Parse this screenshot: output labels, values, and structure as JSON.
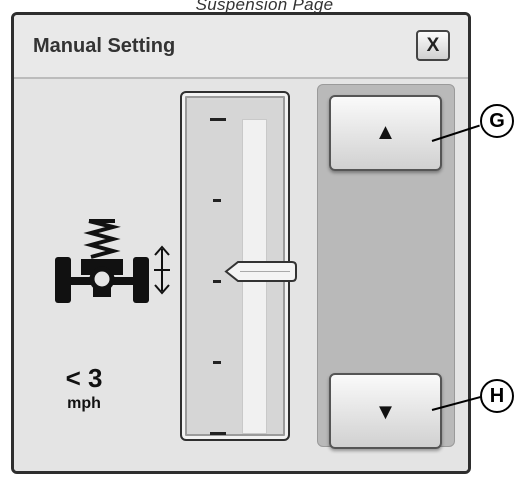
{
  "caption": "Suspension Page",
  "dialog": {
    "title": "Manual Setting",
    "close_label": "X"
  },
  "speed": {
    "value": "< 3",
    "unit": "mph"
  },
  "slider": {
    "level_fraction": 0.5,
    "tick_count": 5
  },
  "buttons": {
    "up_glyph": "▲",
    "down_glyph": "▼"
  },
  "callouts": {
    "up": "G",
    "down": "H"
  },
  "icons": {
    "suspension": "suspension-spring-axle-icon",
    "updown": "up-down-arrow-icon"
  }
}
